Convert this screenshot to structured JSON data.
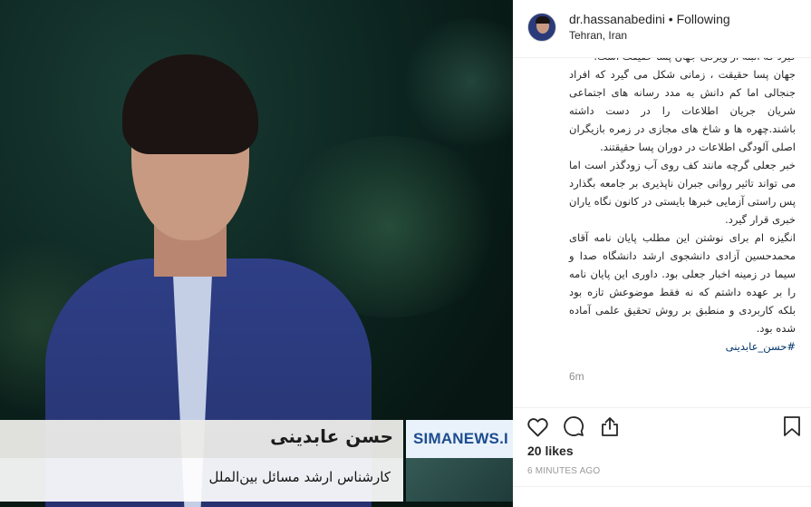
{
  "media": {
    "lower_third": {
      "name": "حسن عابدینی",
      "title": "کارشناس ارشد مسائل بین‌الملل",
      "brand": "SIMANEWS.I"
    }
  },
  "post": {
    "username": "dr.hassanabedini",
    "separator": "•",
    "follow_state": "Following",
    "location": "Tehran, Iran",
    "caption_paragraphs": [
      "گیرد که البته از ویژگی جهان پسا حقیقت است.",
      "جهان پسا حقیقت ، زمانی شکل می گیرد که افراد جنجالی اما کم دانش به مدد رسانه های اجتماعی شریان جریان اطلاعات را در دست داشته باشند.چهره ها و شاخ های مجازی در زمره بازیگران اصلی آلودگی اطلاعات در دوران پسا حقیقتند.",
      "خبر جعلی گرچه مانند کف روی آب زودگذر است اما می تواند تاثیر روانی جبران ناپذیری بر جامعه بگذارد پس راستی آزمایی خبرها بایستی در کانون نگاه یاران خبری قرار گیرد.",
      "انگیزه ام برای نوشتن این مطلب پایان نامه آقای محمدحسین آزادی دانشجوی ارشد دانشگاه صدا و سیما در زمینه اخبار جعلی بود. داوری این پایان نامه را بر عهده داشتم که نه فقط موضوعش تازه بود بلکه کاربردی و منطبق بر روش تحقیق علمی آماده شده بود."
    ],
    "hashtag": "#حسن_عابدینی",
    "relative_time": "6m",
    "likes": "20 likes",
    "timestamp": "6 MINUTES AGO"
  },
  "icons": {
    "like": "heart-icon",
    "comment": "speech-bubble-icon",
    "share": "share-icon",
    "save": "bookmark-icon"
  }
}
